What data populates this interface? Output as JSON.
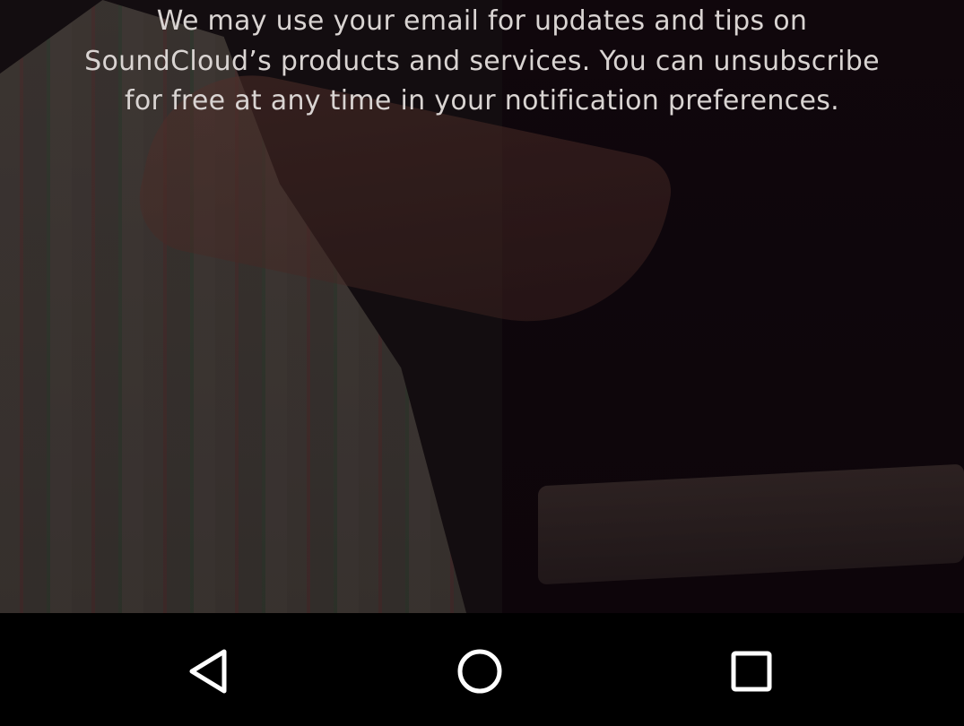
{
  "notice": {
    "line1": "We may use your email for updates and tips on",
    "line2": "SoundCloud’s products and services. You can unsubscribe",
    "line3": "for free at any time in your notification preferences."
  },
  "navigation_bar": {
    "back_icon": "triangle-back-icon",
    "home_icon": "circle-home-icon",
    "recents_icon": "square-recents-icon",
    "icon_color": "#ffffff",
    "background": "#000000"
  }
}
